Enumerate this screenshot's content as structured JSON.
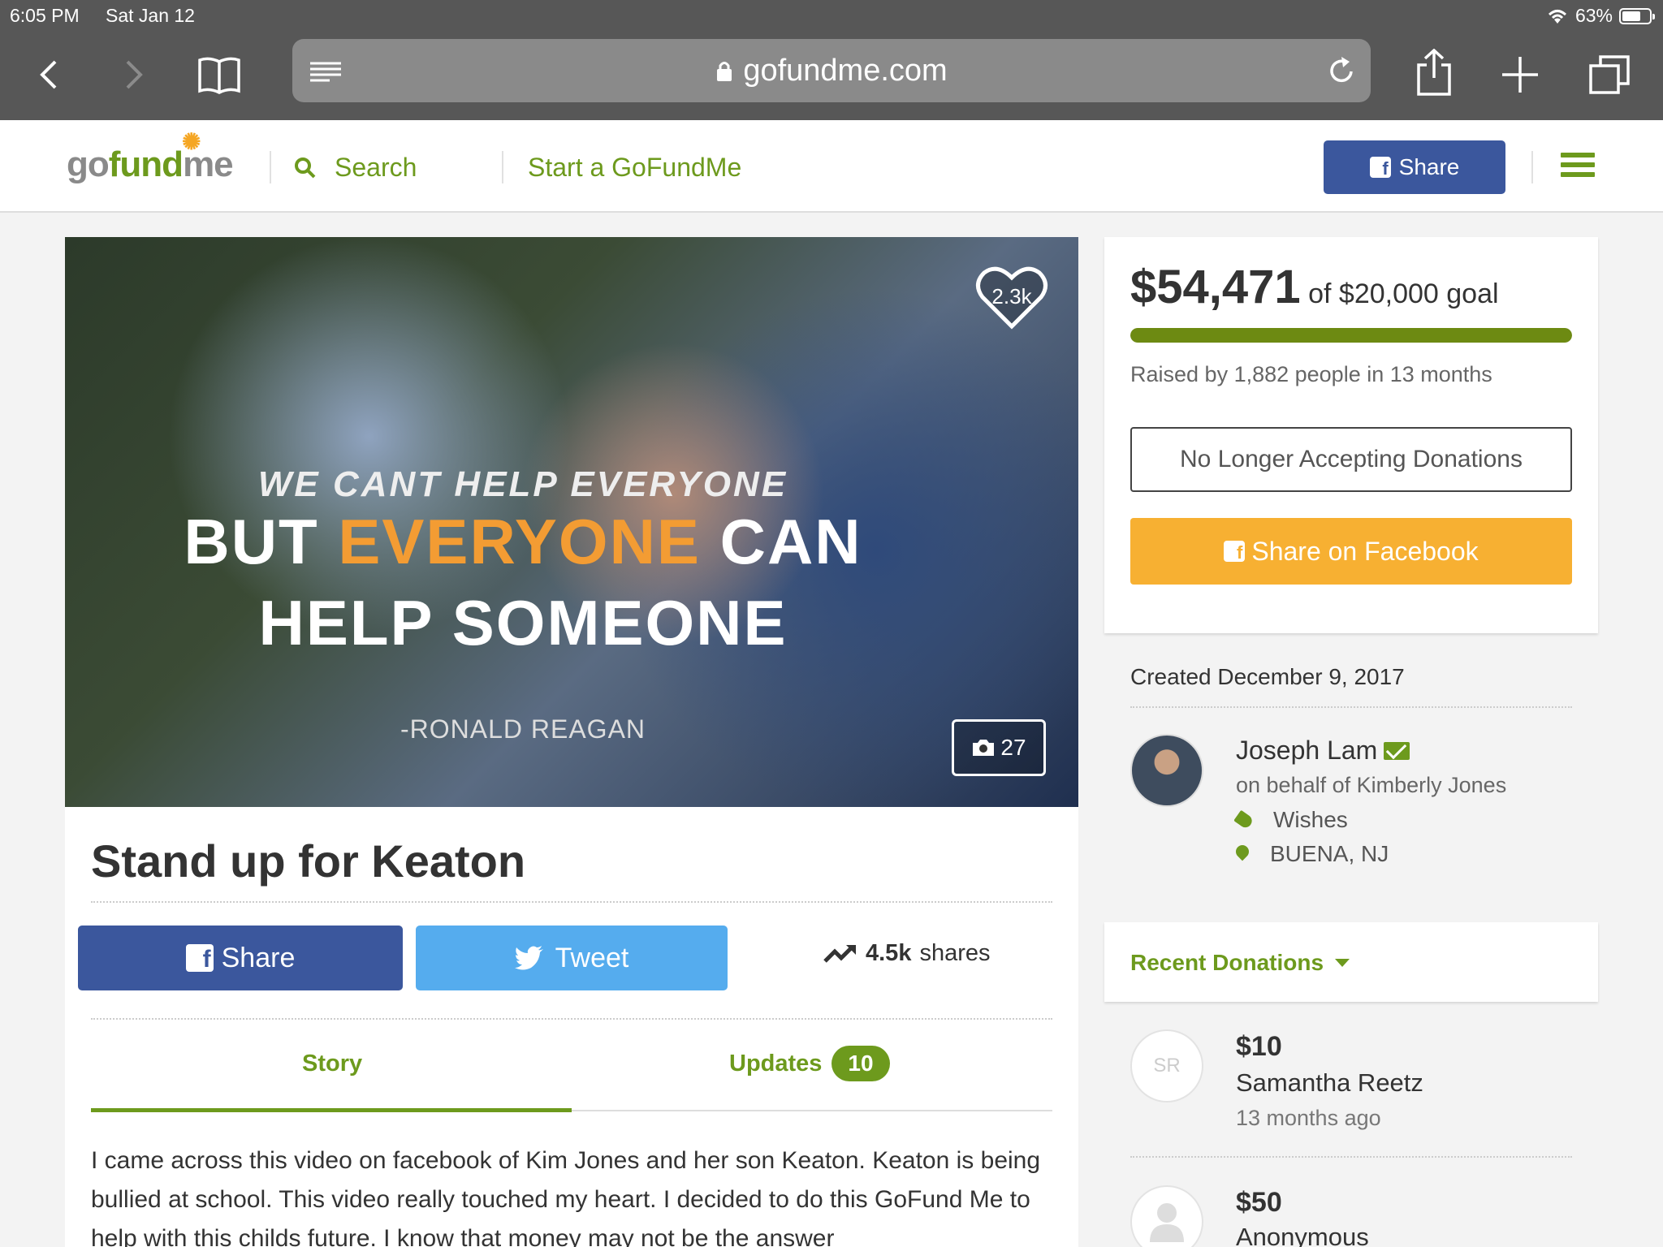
{
  "status": {
    "time": "6:05 PM",
    "date": "Sat Jan 12",
    "battery": "63%"
  },
  "browser": {
    "url": "gofundme.com"
  },
  "header": {
    "logo": {
      "go": "go",
      "fund": "fund",
      "me": "me"
    },
    "search": "Search",
    "start": "Start a GoFundMe",
    "share": "Share"
  },
  "campaign": {
    "hero": {
      "line1": "WE CANT HELP EVERYONE",
      "line2a": "BUT",
      "line2b": "EVERYONE",
      "line2c": "CAN",
      "line3": "HELP SOMEONE",
      "attribution": "-RONALD REAGAN",
      "hearts": "2.3k",
      "photos": "27"
    },
    "title": "Stand up for Keaton",
    "share_button": "Share",
    "tweet_button": "Tweet",
    "shares_count": "4.5k",
    "shares_label": "shares",
    "tabs": {
      "story": "Story",
      "updates": "Updates",
      "updates_count": "10"
    },
    "story": "I came across this video on facebook of Kim Jones and her son Keaton.  Keaton is being bullied at school.  This video really touched my heart.  I decided to do this GoFund Me to help with this childs future.  I know that money may not be the answer"
  },
  "sidebar": {
    "raised": "$54,471",
    "goal": "of $20,000 goal",
    "progress_percent": 100,
    "raised_by": "Raised by 1,882 people in 13 months",
    "no_longer": "No Longer Accepting Donations",
    "share_fb": "Share on Facebook",
    "created": "Created December 9, 2017",
    "organizer": "Joseph Lam",
    "on_behalf": "on behalf of Kimberly Jones",
    "category": "Wishes",
    "location": "BUENA, NJ",
    "recent_label": "Recent Donations",
    "donations": [
      {
        "initials": "SR",
        "amount": "$10",
        "name": "Samantha Reetz",
        "time": "13 months ago"
      },
      {
        "amount": "$50",
        "name": "Anonymous"
      }
    ]
  }
}
